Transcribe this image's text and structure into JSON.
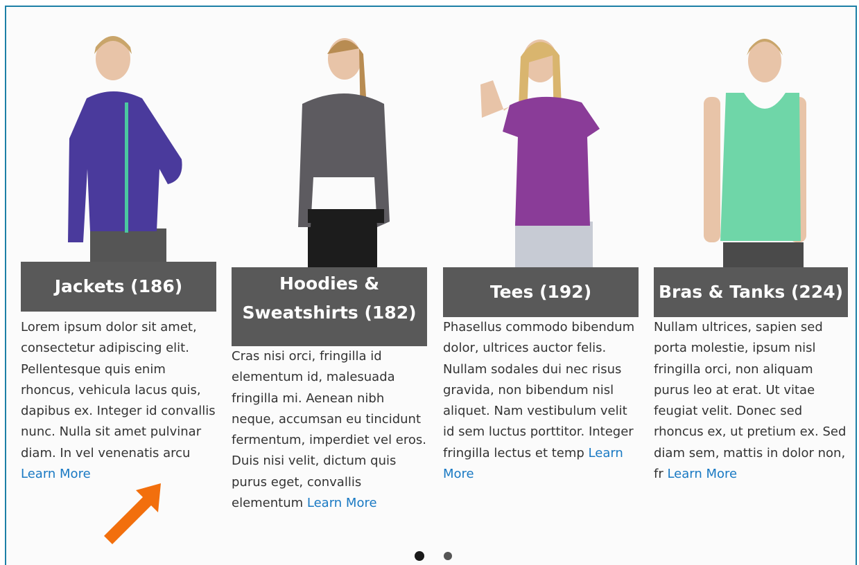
{
  "categories": [
    {
      "title": "Jackets (186)",
      "description": "Lorem ipsum dolor sit amet, consectetur adipiscing elit. Pellentesque quis enim rhoncus, vehicula lacus quis, dapibus ex. Integer id convallis nunc. Nulla sit amet pulvinar diam. In vel venenatis arcu ",
      "link": "Learn More",
      "image_icon": "jacket-model-photo",
      "garment_color": "#4a3a9c"
    },
    {
      "title": "Hoodies & Sweatshirts (182)",
      "description": "Cras nisi orci, fringilla id elementum id, malesuada fringilla mi. Aenean nibh neque, accumsan eu tincidunt fermentum, imperdiet vel eros. Duis nisi velit, dictum quis purus eget, convallis elementum ",
      "link": "Learn More",
      "image_icon": "hoodie-model-photo",
      "garment_color": "#5d5b60"
    },
    {
      "title": "Tees (192)",
      "description": "Phasellus commodo bibendum dolor, ultrices auctor felis. Nullam sodales dui nec risus gravida, non bibendum nisl aliquet. Nam vestibulum velit id sem luctus porttitor. Integer fringilla lectus et temp ",
      "link": "Learn More",
      "image_icon": "tee-model-photo",
      "garment_color": "#8a3c98"
    },
    {
      "title": "Bras & Tanks (224)",
      "description": "Nullam ultrices, sapien sed porta molestie, ipsum nisl fringilla orci, non aliquam purus leo at erat. Ut vitae feugiat velit. Donec sed rhoncus ex, ut pretium ex. Sed diam sem, mattis in dolor non, fr ",
      "link": "Learn More",
      "image_icon": "tank-model-photo",
      "garment_color": "#6fd6a8"
    }
  ],
  "carousel": {
    "active_page": 1,
    "total_pages": 2
  },
  "annotation": {
    "icon": "orange-arrow-icon",
    "color": "#f26f0d"
  },
  "colors": {
    "title_bg": "#595959",
    "link": "#1979c3",
    "frame_border": "#1c7fa6"
  }
}
